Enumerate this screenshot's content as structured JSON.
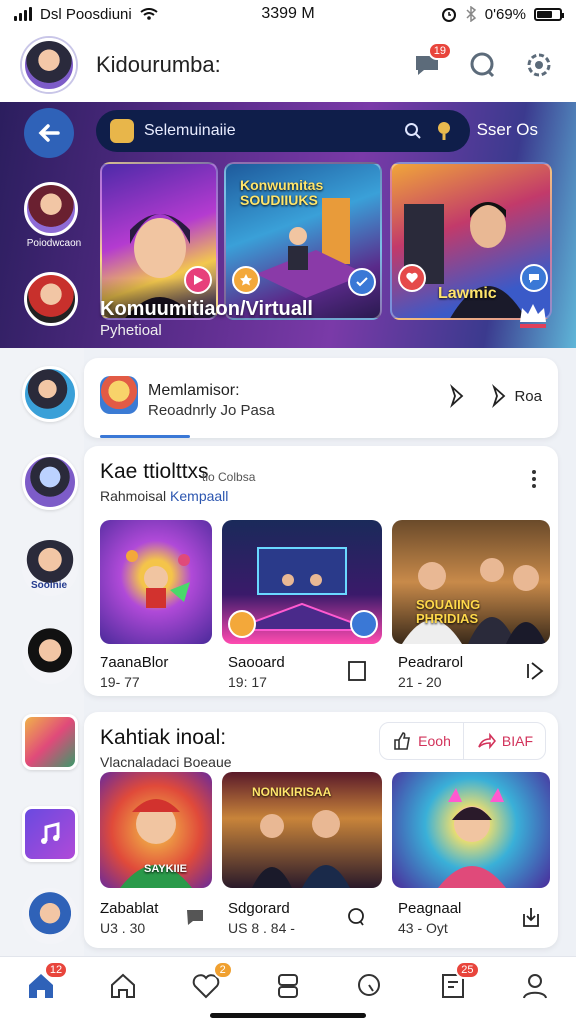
{
  "status_bar": {
    "carrier": "Dsl Poosdiuni",
    "time": "3399 M",
    "battery": "0'69%",
    "battery_level": 0.69
  },
  "header": {
    "title": "Kidourumba:",
    "chat_badge": "19"
  },
  "hero": {
    "search_placeholder": "Selemuinaiie",
    "right_link": "Sser Os",
    "story_label": "Poiodwcaon",
    "tiles": [
      {
        "tag": ""
      },
      {
        "tag": "Konwumitas\nSOUDIIUKS"
      },
      {
        "tag": "Lawmic"
      }
    ],
    "title": "Komuumitiaon/Virtuall",
    "subtitle": "Pyhetioal"
  },
  "rail": {
    "tags": [
      "Sooinie"
    ]
  },
  "message_card": {
    "title": "Memlamisor:",
    "subtitle": "Reoadnrly Jo Pasa",
    "action_label": "Roa"
  },
  "section1": {
    "title": "Kae ttiolttxs",
    "subtitle_a": "Rahmoisal",
    "subtitle_b": "Kempaall",
    "subtitle_overlay": "tio Colbsa",
    "items": [
      {
        "caption": "7aanaBlor",
        "meta": "19- 77"
      },
      {
        "caption": "Saooard",
        "meta": "19: 17"
      },
      {
        "caption": "Peadrarol",
        "meta": "21 - 20",
        "tile_text": "SOUAIING\nPHRIDIAS"
      }
    ]
  },
  "section2": {
    "title": "Kahtiak inoal:",
    "subtitle": "Vlacnaladaci Boeaue",
    "pill_left": "Eooh",
    "pill_right": "BIAF",
    "items": [
      {
        "caption": "Zabablat",
        "meta": "U3 . 30",
        "tile_text": "SAYKIIE"
      },
      {
        "caption": "Sdgorard",
        "meta": "US 8 . 84 -",
        "tile_text": "NONIKIRISAA"
      },
      {
        "caption": "Peagnaal",
        "meta": "43 - Oyt"
      }
    ]
  },
  "bottom_nav": {
    "badge_home": "12",
    "badge_heart": "2",
    "badge_notes": "25"
  },
  "colors": {
    "accent": "#2f62b8",
    "badge": "#e8453c",
    "hero_start": "#2b1e5e",
    "hero_end": "#5fb6d8"
  }
}
